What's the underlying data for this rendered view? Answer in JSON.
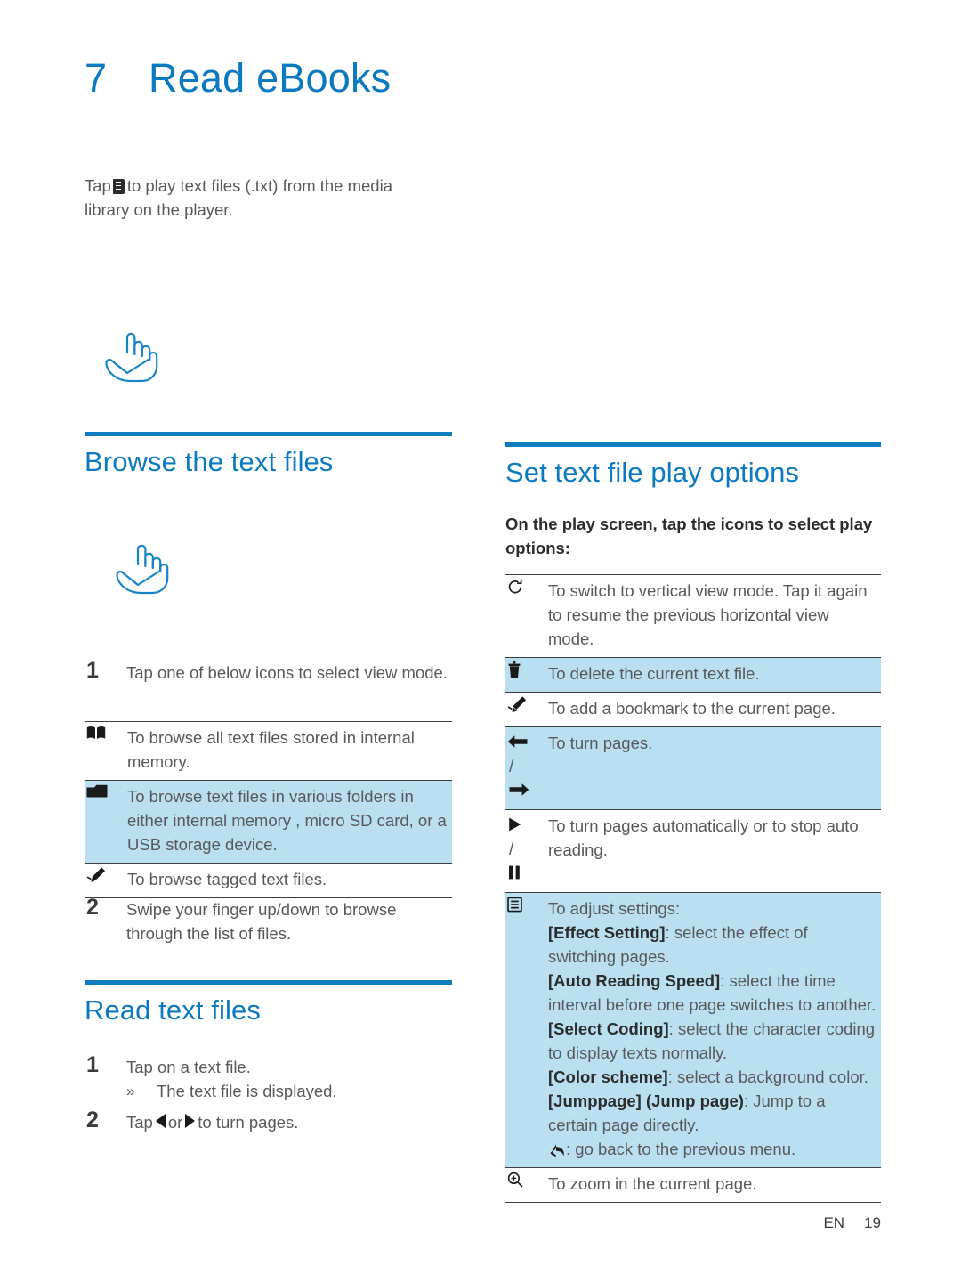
{
  "document": {
    "chapter_number": "7",
    "chapter_title": "Read eBooks",
    "intro_before_icon": "Tap",
    "intro_icon": "ebook-icon",
    "intro_after_icon": "to play text files (.txt) from the media library on the player."
  },
  "left_column": {
    "hand_icon_top": "tap-hand-icon",
    "hand_icon_mid": "tap-hand-icon",
    "browse_section": {
      "heading": "Browse the text files",
      "steps": [
        {
          "number": "1",
          "text": "Tap one of below icons to select view mode."
        },
        {
          "number": "2",
          "text": "Swipe your finger up/down to browse through the list of files."
        }
      ],
      "table": [
        {
          "icon": "book-icon",
          "description": "To browse all text files stored in internal memory.",
          "highlighted": false
        },
        {
          "icon": "folder-icon",
          "description": "To browse text files in various folders in either internal memory , micro SD card, or a USB storage device.",
          "highlighted": true
        },
        {
          "icon": "tag-icon",
          "description": "To browse tagged text files.",
          "highlighted": false
        }
      ]
    },
    "read_section": {
      "heading": "Read text files",
      "step1_number": "1",
      "step1_text": "Tap on a text file.",
      "substep_marker": "»",
      "substep_text": "The text file is displayed.",
      "step2_number": "2",
      "step2_prefix": "Tap",
      "step2_middle": "or",
      "step2_suffix": "to turn pages."
    }
  },
  "right_column": {
    "heading": "Set text file play options",
    "intro": "On the play screen, tap the icons to select play options:",
    "table": [
      {
        "icons": [
          "rotate-icon"
        ],
        "description": "To switch to vertical view mode. Tap it again to resume the previous horizontal view mode.",
        "highlighted": false
      },
      {
        "icons": [
          "trash-icon"
        ],
        "description": "To delete the current text file.",
        "highlighted": true
      },
      {
        "icons": [
          "bookmark-tag-icon"
        ],
        "description": "To add a bookmark to the current page.",
        "highlighted": false
      },
      {
        "icons": [
          "arrow-left-icon",
          "slash",
          "arrow-right-icon"
        ],
        "description": "To turn pages.",
        "highlighted": true
      },
      {
        "icons": [
          "play-icon",
          "slash",
          "pause-icon"
        ],
        "description": "To turn pages automatically or to stop auto reading.",
        "highlighted": false
      },
      {
        "icons": [
          "settings-list-icon"
        ],
        "description": "To adjust settings:",
        "highlighted": true,
        "settings": [
          {
            "label": "[Effect Setting]",
            "text": ": select the effect of switching pages."
          },
          {
            "label": "[Auto Reading Speed]",
            "text": ": select the time interval before one page switches to another."
          },
          {
            "label": "[Select Coding]",
            "text": ": select the character coding to display texts normally."
          },
          {
            "label": "[Color scheme]",
            "text": ": select a background color."
          },
          {
            "label": "[Jumppage] (Jump page)",
            "text": ": Jump to a certain page directly."
          }
        ],
        "back_note": ": go back to the previous menu.",
        "back_icon": "back-arrow-icon"
      },
      {
        "icons": [
          "zoom-in-icon"
        ],
        "description": "To zoom in the current page.",
        "highlighted": false
      }
    ]
  },
  "footer": {
    "language": "EN",
    "page_number": "19"
  },
  "colors": {
    "accent_blue": "#0b7ac0",
    "rule_blue": "#0f7cc0",
    "highlight_blue": "#b9dff1",
    "body_gray": "#58595b",
    "rule_dark": "#3c3c3c"
  }
}
